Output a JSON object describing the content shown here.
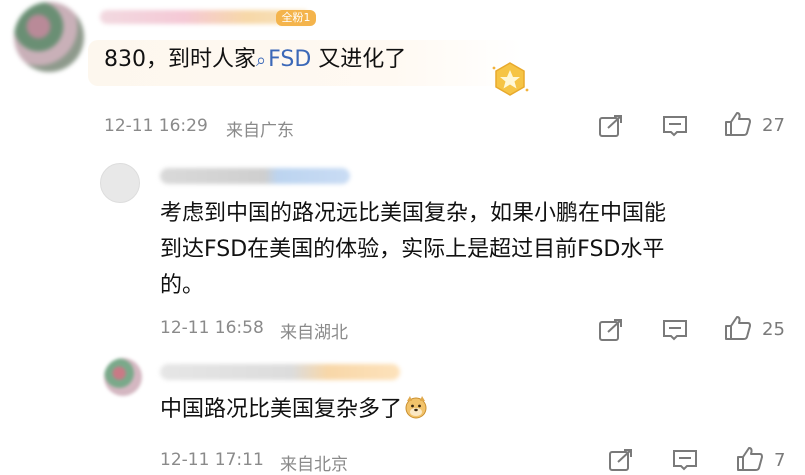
{
  "comments": [
    {
      "badge": "全粉1",
      "text_prefix": "830，到时人家",
      "hashtag": "FSD",
      "text_suffix": " 又进化了",
      "time": "12-11 16:29",
      "location": "来自广东",
      "likes": "27"
    }
  ],
  "replies": [
    {
      "text_line1": "考虑到中国的路况远比美国复杂，如果小鹏在中国能",
      "text_line2": "到达FSD在美国的体验，实际上是超过目前FSD水平",
      "text_line3": "的。",
      "time": "12-11 16:58",
      "location": "来自湖北",
      "likes": "25"
    },
    {
      "text_line1": "中国路况比美国复杂多了",
      "time": "12-11 17:11",
      "location": "来自北京",
      "likes": "7"
    }
  ],
  "icons": {
    "share": "share-icon",
    "comment": "comment-icon",
    "like": "thumbs-up-icon",
    "emoji": "doge-emoji-icon",
    "badge": "star-badge-icon",
    "hashtag": "search-icon"
  },
  "colors": {
    "hashtag": "#3b68b8",
    "meta": "#8a8a8a",
    "bubble": "#fdf7ee"
  }
}
